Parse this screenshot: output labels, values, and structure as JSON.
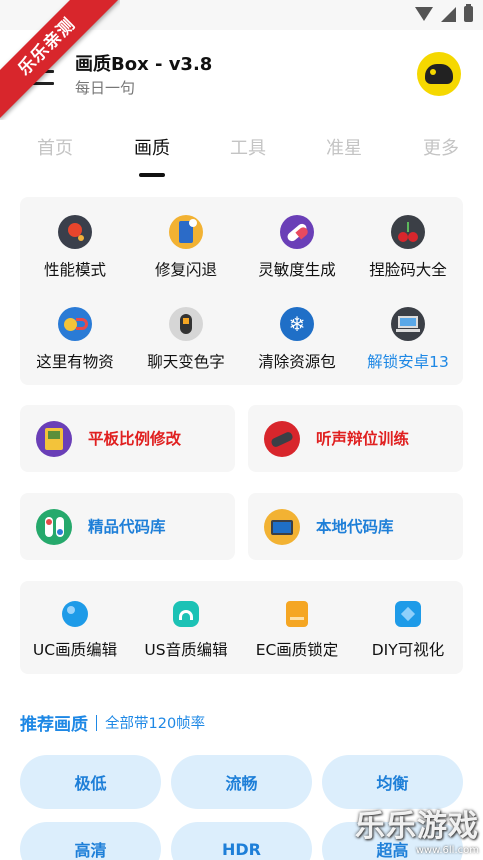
{
  "ribbon": {
    "label": "乐乐亲测"
  },
  "app_bar": {
    "title": "画质Box - v3.8",
    "subtitle": "每日一句",
    "menu_icon": "hamburger-menu-icon",
    "avatar_icon": "helmet-avatar-icon"
  },
  "tabs": [
    {
      "label": "首页",
      "active": false
    },
    {
      "label": "画质",
      "active": true
    },
    {
      "label": "工具",
      "active": false
    },
    {
      "label": "准星",
      "active": false
    },
    {
      "label": "更多",
      "active": false
    }
  ],
  "grid_top": [
    {
      "label": "性能模式",
      "icon": "rocket-icon"
    },
    {
      "label": "修复闪退",
      "icon": "phone-repair-icon"
    },
    {
      "label": "灵敏度生成",
      "icon": "capsule-icon"
    },
    {
      "label": "捏脸码大全",
      "icon": "cherry-icon"
    },
    {
      "label": "这里有物资",
      "icon": "coin-magnet-icon"
    },
    {
      "label": "聊天变色字",
      "icon": "brush-icon"
    },
    {
      "label": "清除资源包",
      "icon": "snowflake-icon"
    },
    {
      "label": "解锁安卓13",
      "icon": "laptop-icon",
      "highlight": true
    }
  ],
  "half_cards": [
    {
      "label": "平板比例修改",
      "icon": "gameboy-icon",
      "color": "red"
    },
    {
      "label": "听声辩位训练",
      "icon": "telescope-icon",
      "color": "red"
    },
    {
      "label": "精品代码库",
      "icon": "toggle-switch-icon",
      "color": "blue"
    },
    {
      "label": "本地代码库",
      "icon": "monitor-icon",
      "color": "blue"
    }
  ],
  "grid_bottom": [
    {
      "label": "UC画质编辑",
      "icon": "blue-orb-icon"
    },
    {
      "label": "US音质编辑",
      "icon": "headphones-icon"
    },
    {
      "label": "EC画质锁定",
      "icon": "orange-document-icon"
    },
    {
      "label": "DIY可视化",
      "icon": "puzzle-icon"
    }
  ],
  "recommended": {
    "title": "推荐画质",
    "subtitle": "全部带120帧率",
    "options": [
      "极低",
      "流畅",
      "均衡",
      "高清",
      "HDR",
      "超高"
    ]
  },
  "watermark": {
    "text": "乐乐游戏",
    "url": "www.6ll.com"
  },
  "colors": {
    "accent_blue": "#1e88e5",
    "accent_red": "#e02020",
    "chip_bg": "#dceefc",
    "card_bg": "#f6f6f6",
    "ribbon": "#d8262c"
  }
}
